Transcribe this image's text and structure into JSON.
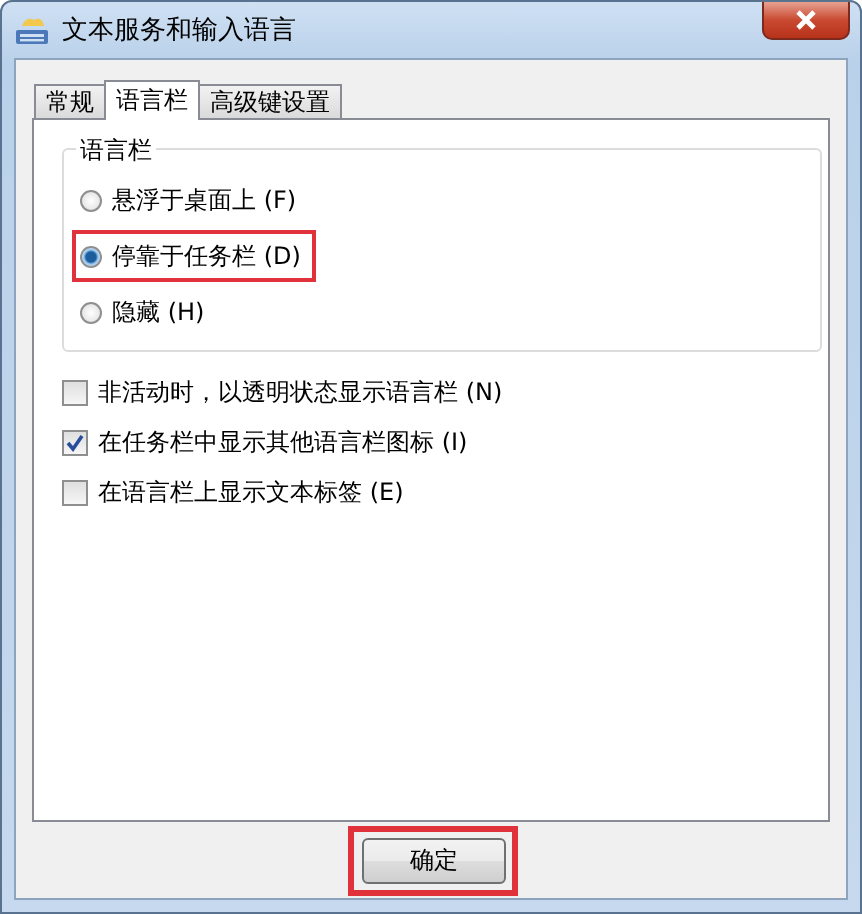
{
  "window": {
    "title": "文本服务和输入语言"
  },
  "tabs": [
    {
      "label": "常规",
      "selected": false
    },
    {
      "label": "语言栏",
      "selected": true
    },
    {
      "label": "高级键设置",
      "selected": false
    }
  ],
  "group": {
    "title": "语言栏",
    "options": [
      {
        "label": "悬浮于桌面上 (F)",
        "selected": false,
        "highlighted": false
      },
      {
        "label": "停靠于任务栏 (D)",
        "selected": true,
        "highlighted": true
      },
      {
        "label": "隐藏 (H)",
        "selected": false,
        "highlighted": false
      }
    ]
  },
  "checkboxes": [
    {
      "label": "非活动时，以透明状态显示语言栏 (N)",
      "checked": false
    },
    {
      "label": "在任务栏中显示其他语言栏图标 (I)",
      "checked": true
    },
    {
      "label": "在语言栏上显示文本标签 (E)",
      "checked": false
    }
  ],
  "buttons": [
    {
      "label": "确定",
      "highlighted": true
    }
  ]
}
